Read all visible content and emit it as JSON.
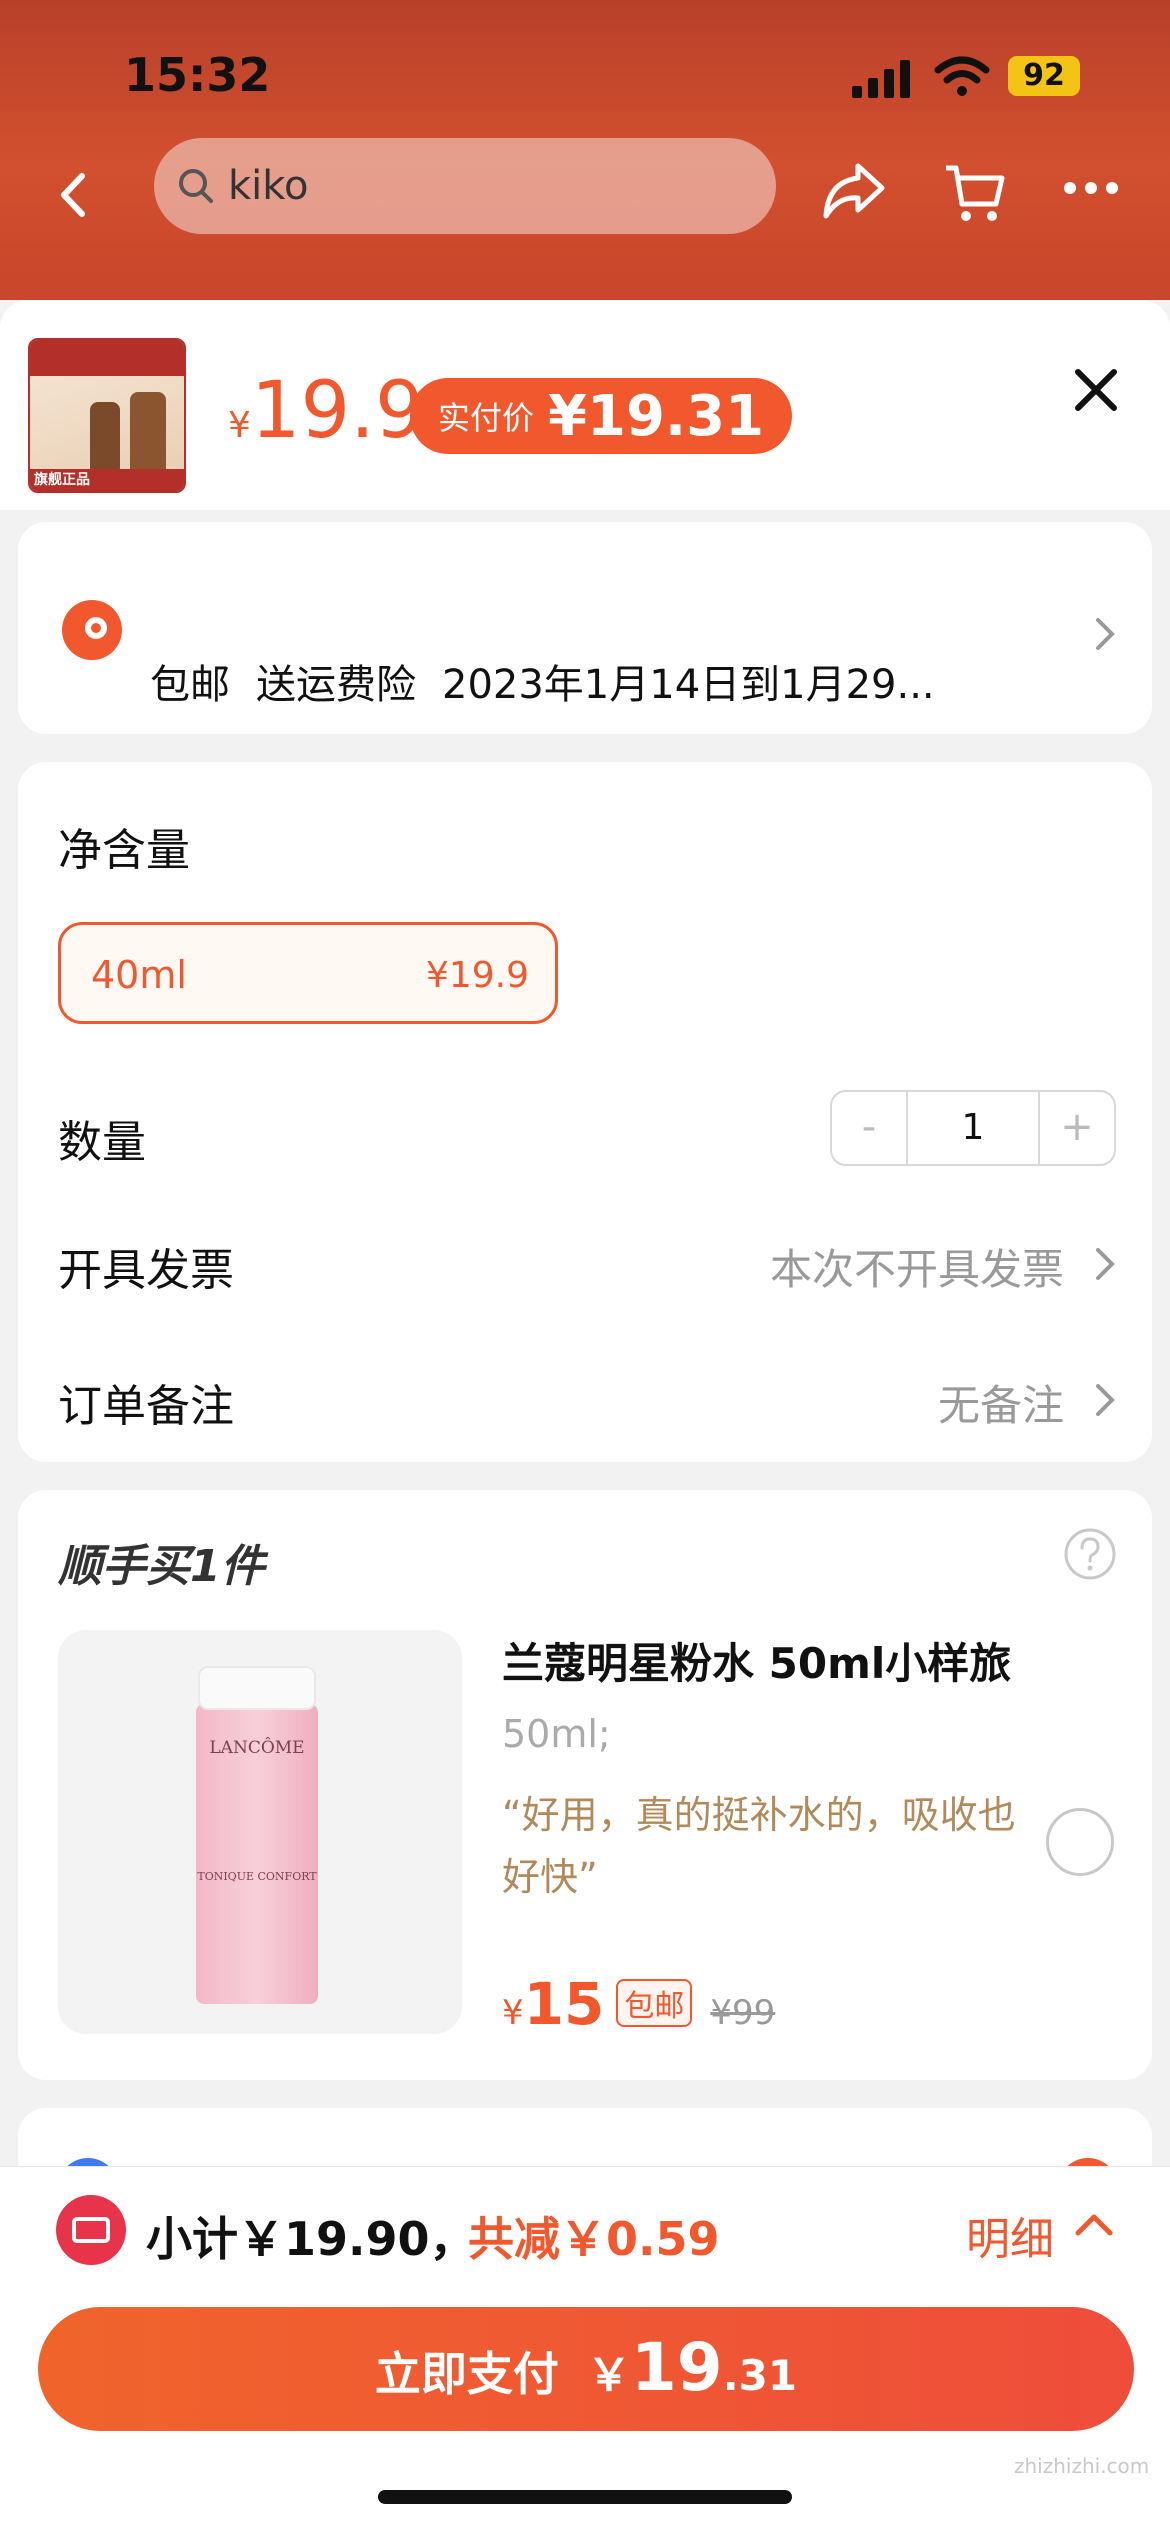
{
  "status_bar": {
    "time": "15:32",
    "battery": "92"
  },
  "nav": {
    "search_text": "kiko"
  },
  "sku_header": {
    "price_currency": "¥",
    "price": "19.9",
    "actual_pay_label": "实付价",
    "actual_pay_value": "¥19.31",
    "thumb_badge": "旗舰正品"
  },
  "shipping": {
    "free_shipping": "包邮",
    "return_insurance": "送运费险",
    "delivery": "2023年1月14日到1月29..."
  },
  "spec": {
    "title": "净含量",
    "options": [
      {
        "name": "40ml",
        "price": "¥19.9",
        "selected": true
      }
    ]
  },
  "quantity": {
    "label": "数量",
    "value": "1",
    "minus": "-",
    "plus": "+"
  },
  "invoice": {
    "label": "开具发票",
    "value": "本次不开具发票"
  },
  "remark": {
    "label": "订单备注",
    "value": "无备注"
  },
  "addon": {
    "title": "顺手买1件",
    "product_name": "兰蔻明星粉水 50ml小样旅",
    "spec": "50ml;",
    "review": "“好用，真的挺补水的，吸收也好快”",
    "price_currency": "¥",
    "price": "15",
    "badge": "包邮",
    "original_price": "¥99",
    "image_brand": "LANCÔME",
    "image_sub": "TONIQUE CONFORT"
  },
  "footer": {
    "subtotal": "小计￥19.90，",
    "reduced": "共减￥0.59",
    "detail_link": "明细",
    "pay_label": "立即支付",
    "pay_currency": "￥",
    "pay_int": "19",
    "pay_dec": ".31"
  },
  "watermark": "zhizhizhi.com",
  "colors": {
    "accent": "#f1582d",
    "review": "#b08a5a",
    "coupon": "#e8344a"
  }
}
